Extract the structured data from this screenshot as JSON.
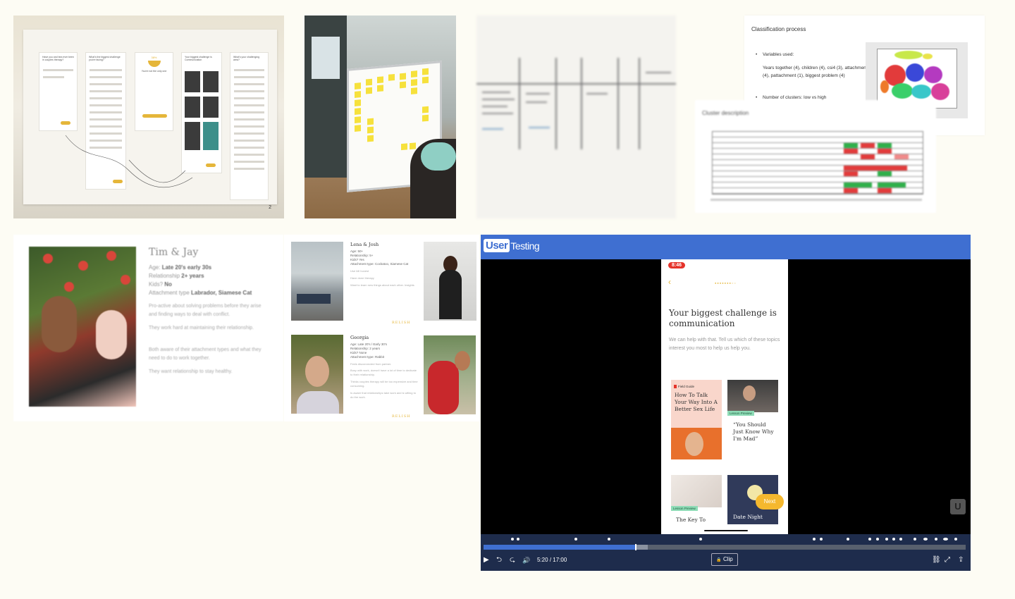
{
  "wall_photo": {
    "page_number": "2",
    "wireframe_questions": [
      "Have you and bea ever been in couples therapy?",
      "What's the biggest challenge you're facing?",
      "Your biggest challenge is Communication",
      "What's your challenging area?"
    ],
    "wireframe_hint": "You're not the only one",
    "wireframe_percent": "38%"
  },
  "classification": {
    "title": "Classification process",
    "bullet_1_label": "Variables used:",
    "bullet_1_detail": "Years together (4), children (4), csi4 (3), attachment (4), pattachment (1), biggest problem (4)",
    "bullet_2": "Number of clusters: low vs high",
    "table_title": "Cluster description"
  },
  "persona_tim_jay": {
    "name": "Tim & Jay",
    "age_label": "Age:",
    "age_value": "Late 20's early 30s",
    "relationship_label": "Relationship",
    "relationship_value": "2+ years",
    "kids_label": "Kids?",
    "kids_value": "No",
    "attachment_label": "Attachment type",
    "attachment_value": "Labrador, Siamese Cat",
    "paragraphs": [
      "Pro-active about solving problems before they arise and finding ways to deal with conflict.",
      "They work hard at maintaining their relationship.",
      "Both aware of their attachment types and what they need to do to work together.",
      "They want relationship to stay healthy."
    ]
  },
  "persona_lena_josh": {
    "name": "Lena & Josh",
    "attrs": [
      "Age: 50+",
      "Relationship: 5+",
      "Kids? Yes",
      "Attachment type: Cockatoo, Siamese Cat"
    ],
    "lines": [
      "Use bill honest",
      "Have done therapy",
      "Want to learn new things about each other. Insights"
    ],
    "brand": "RELISH"
  },
  "persona_georgia": {
    "name": "Georgia",
    "attrs": [
      "Age: Late 20's / Early 30's",
      "Relationship: 2 years",
      "Kids? None",
      "Attachment type: Rabbit"
    ],
    "lines": [
      "Feels disconnected from partner.",
      "Busy with work, doesn't have a lot of time to dedicate to their relationship.",
      "Thinks couples therapy will be too expensive and time consuming.",
      "Is aware that relationships take work and is willing to do the work."
    ],
    "brand": "RELISH"
  },
  "player": {
    "logo_box": "User",
    "logo_text": "Testing",
    "phone_time": "8:46",
    "screen_title": "Your biggest challenge is communication",
    "screen_subtitle": "We can help with that. Tell us which of these topics interest you most to help us help you.",
    "tile1_tag": "Field Guide",
    "tile1_title": "How To Talk Your Way Into A Better Sex Life",
    "tile2_tag": "Lesson Preview",
    "tile2_title": "“You Should Just Know Why I'm Mad”",
    "tile3_tag": "Lesson Preview",
    "tile3_title": "The Key To",
    "tile4_title": "Date Night",
    "next_label": "Next",
    "watermark": "U",
    "current_time": "5:20",
    "separator": "/",
    "total_time": "17:00",
    "clip_label": "Clip",
    "progress_fraction": 0.3137,
    "buffer_fraction": 0.34
  },
  "icons": {
    "play": "▶",
    "back": "⮌",
    "forward": "⮎",
    "volume": "🔊",
    "lock": "🔒",
    "unlink": "⛓",
    "fullscreen": "⤢",
    "share": "⇪",
    "chevron": "‹"
  },
  "colors": {
    "brand_blue": "#3f6fd1",
    "accent_yellow": "#f5b82e",
    "timer_red": "#e5332a",
    "controls_bg": "#1e2c4c"
  }
}
